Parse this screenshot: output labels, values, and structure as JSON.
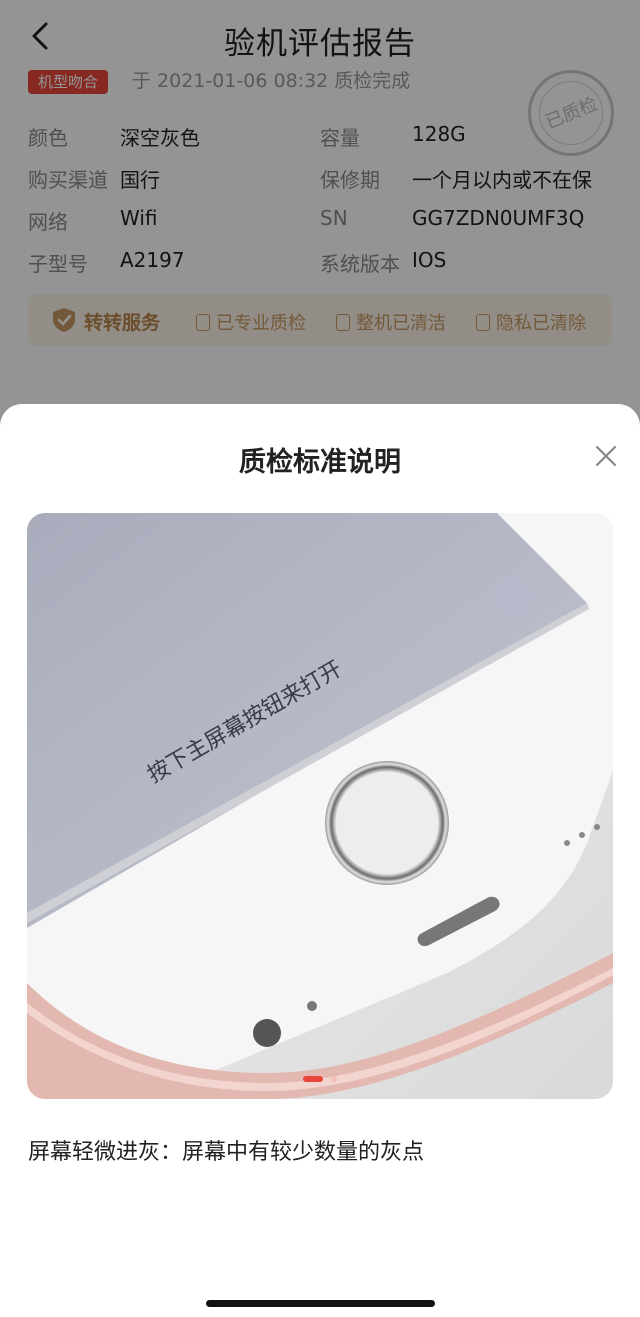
{
  "header": {
    "title": "验机评估报告",
    "back_icon": "chevron-left-icon"
  },
  "summary": {
    "match_badge": "机型吻合",
    "partial_date": "于 2021-01-06 08:32 质检完成",
    "stamp": "已质检"
  },
  "specs": [
    {
      "label": "颜色",
      "value": "深空灰色",
      "label2": "容量",
      "value2": "128G"
    },
    {
      "label": "购买渠道",
      "value": "国行",
      "label2": "保修期",
      "value2": "一个月以内或不在保"
    },
    {
      "label": "网络",
      "value": "Wifi",
      "label2": "SN",
      "value2": "GG7ZDN0UMF3Q"
    },
    {
      "label": "子型号",
      "value": "A2197",
      "label2": "系统版本",
      "value2": "IOS"
    }
  ],
  "service": {
    "main": "转转服务",
    "items": [
      "已专业质检",
      "整机已清洁",
      "隐私已清除"
    ],
    "accent": "#b8864a"
  },
  "modal": {
    "title": "质检标准说明",
    "close_icon": "close-icon",
    "photo_caption": "按下主屏幕按钮来打开",
    "pager": {
      "current": 1,
      "total": 2
    },
    "description": "屏幕轻微进灰：屏幕中有较少数量的灰点"
  },
  "colors": {
    "badge": "#e8473a",
    "service_bg": "#fbf3e7",
    "service_text": "#c79a62"
  }
}
